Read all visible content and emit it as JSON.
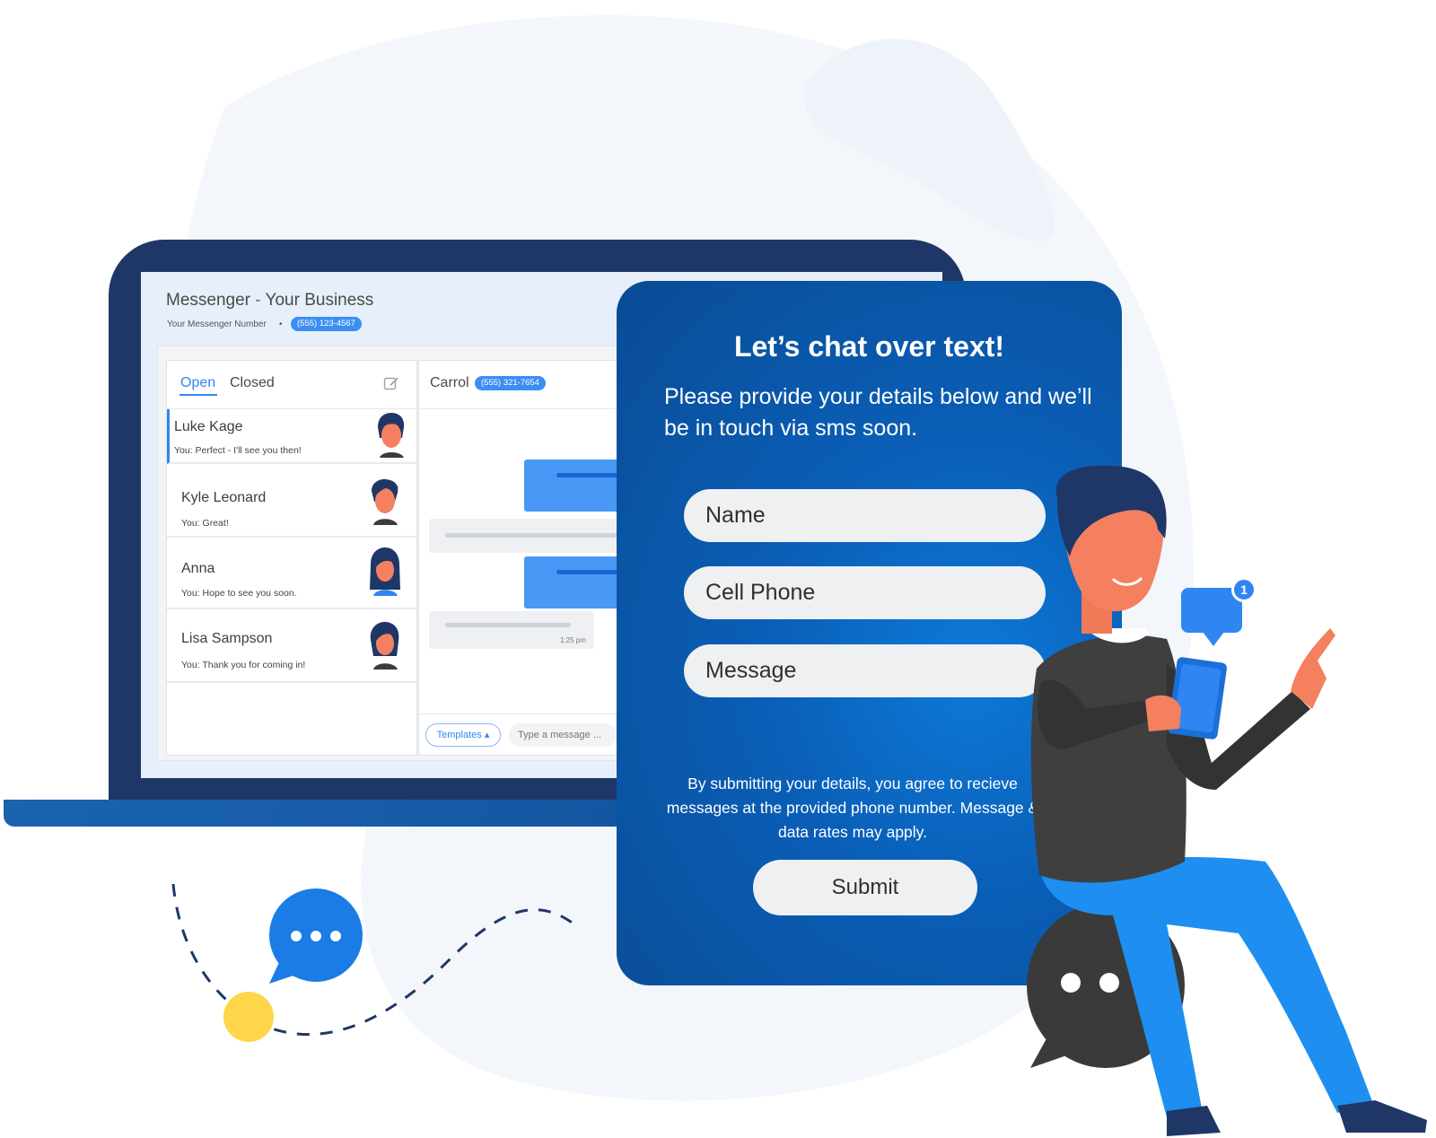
{
  "app": {
    "title": "Messenger",
    "title_sep": " - ",
    "business": "Your Business",
    "number_label": "Your Messenger Number",
    "number_sep": "•",
    "number": "(555) 123-4567"
  },
  "tabs": {
    "open": "Open",
    "closed": "Closed"
  },
  "conversations": [
    {
      "name": "Luke Kage",
      "snippet": "You: Perfect - I'll see you then!"
    },
    {
      "name": "Kyle Leonard",
      "snippet": "You: Great!"
    },
    {
      "name": "Anna",
      "snippet": "You: Hope to see you soon."
    },
    {
      "name": "Lisa Sampson",
      "snippet": "You: Thank you for coming in!"
    }
  ],
  "chat": {
    "contact": "Carrol",
    "number": "(555) 321-7654",
    "last_time": "1:25 pm",
    "templates_label": "Templates ▴",
    "input_placeholder": "Type a message ..."
  },
  "form": {
    "title": "Let’s chat over text!",
    "subtitle": "Please provide your details below and we’ll be in touch via sms soon.",
    "name_placeholder": "Name",
    "phone_placeholder": "Cell Phone",
    "message_placeholder": "Message",
    "disclaimer": "By submitting your details, you agree to recieve messages at the provided phone number. Message & data rates may apply.",
    "submit_label": "Submit"
  },
  "notification": {
    "count": "1"
  },
  "colors": {
    "brand_blue": "#2f86f2",
    "laptop_navy": "#1f3766",
    "card_blue": "#0a5fb8",
    "accent_yellow": "#ffd54a"
  }
}
